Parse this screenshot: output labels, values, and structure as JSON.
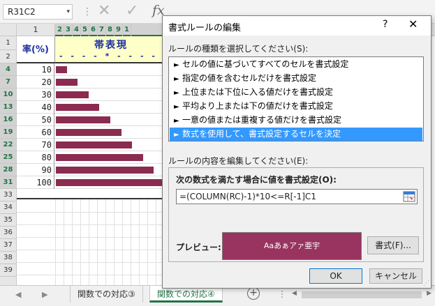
{
  "formula_bar": {
    "name_box": "R31C2",
    "name_box_arrow": "▾",
    "separator": "⋮",
    "cancel_glyph": "✕",
    "enter_glyph": "✓",
    "fx": "fx"
  },
  "sheet": {
    "col_a_header": "1",
    "col_numbers": [
      "2",
      "3",
      "4",
      "5",
      "6",
      "7",
      "8",
      "9",
      "1"
    ],
    "row_headers": [
      "1",
      "2",
      "4",
      "7",
      "10",
      "13",
      "16",
      "19",
      "22",
      "25",
      "28",
      "31",
      "33",
      "34",
      "35",
      "36",
      "37",
      "38",
      "39"
    ],
    "title_a": "率(%)",
    "title_b": "帯表現",
    "ruler": "- - - - * - - - -",
    "rows": [
      {
        "rate": "10",
        "value": 10
      },
      {
        "rate": "20",
        "value": 20
      },
      {
        "rate": "30",
        "value": 30
      },
      {
        "rate": "40",
        "value": 40
      },
      {
        "rate": "50",
        "value": 50
      },
      {
        "rate": "60",
        "value": 60
      },
      {
        "rate": "70",
        "value": 70
      },
      {
        "rate": "80",
        "value": 80
      },
      {
        "rate": "90",
        "value": 90
      },
      {
        "rate": "100",
        "value": 100
      }
    ]
  },
  "tabs": {
    "nav_prev": "◀",
    "nav_next": "▶",
    "tab1": "関数での対応③",
    "tab2": "関数での対応④",
    "add": "+",
    "more": "⋮",
    "scroll_left": "◀",
    "scroll_right": "▶"
  },
  "dialog": {
    "title": "書式ルールの編集",
    "help": "?",
    "close": "✕",
    "type_label": "ルールの種類を選択してください(S):",
    "rule_arrow": "►",
    "rules": [
      "セルの値に基づいてすべてのセルを書式設定",
      "指定の値を含むセルだけを書式設定",
      "上位または下位に入る値だけを書式設定",
      "平均より上または下の値だけを書式設定",
      "一意の値または重複する値だけを書式設定",
      "数式を使用して、書式設定するセルを決定"
    ],
    "edit_label": "ルールの内容を編集してください(E):",
    "formula_label": "次の数式を満たす場合に値を書式設定(O):",
    "formula_value": "=(COLUMN(RC)-1)*10<=R[-1]C1",
    "preview_label": "プレビュー:",
    "preview_text": "Aaあぁアァ亜宇",
    "format_button": "書式(F)...",
    "ok_button": "OK",
    "cancel_button": "キャンセル",
    "grip": "⋰"
  },
  "colors": {
    "bar": "#8b2b4f",
    "preview_bg": "#99335f",
    "selection": "#3399ff",
    "excel_green": "#217346",
    "header_text": "#1a2fa0"
  }
}
